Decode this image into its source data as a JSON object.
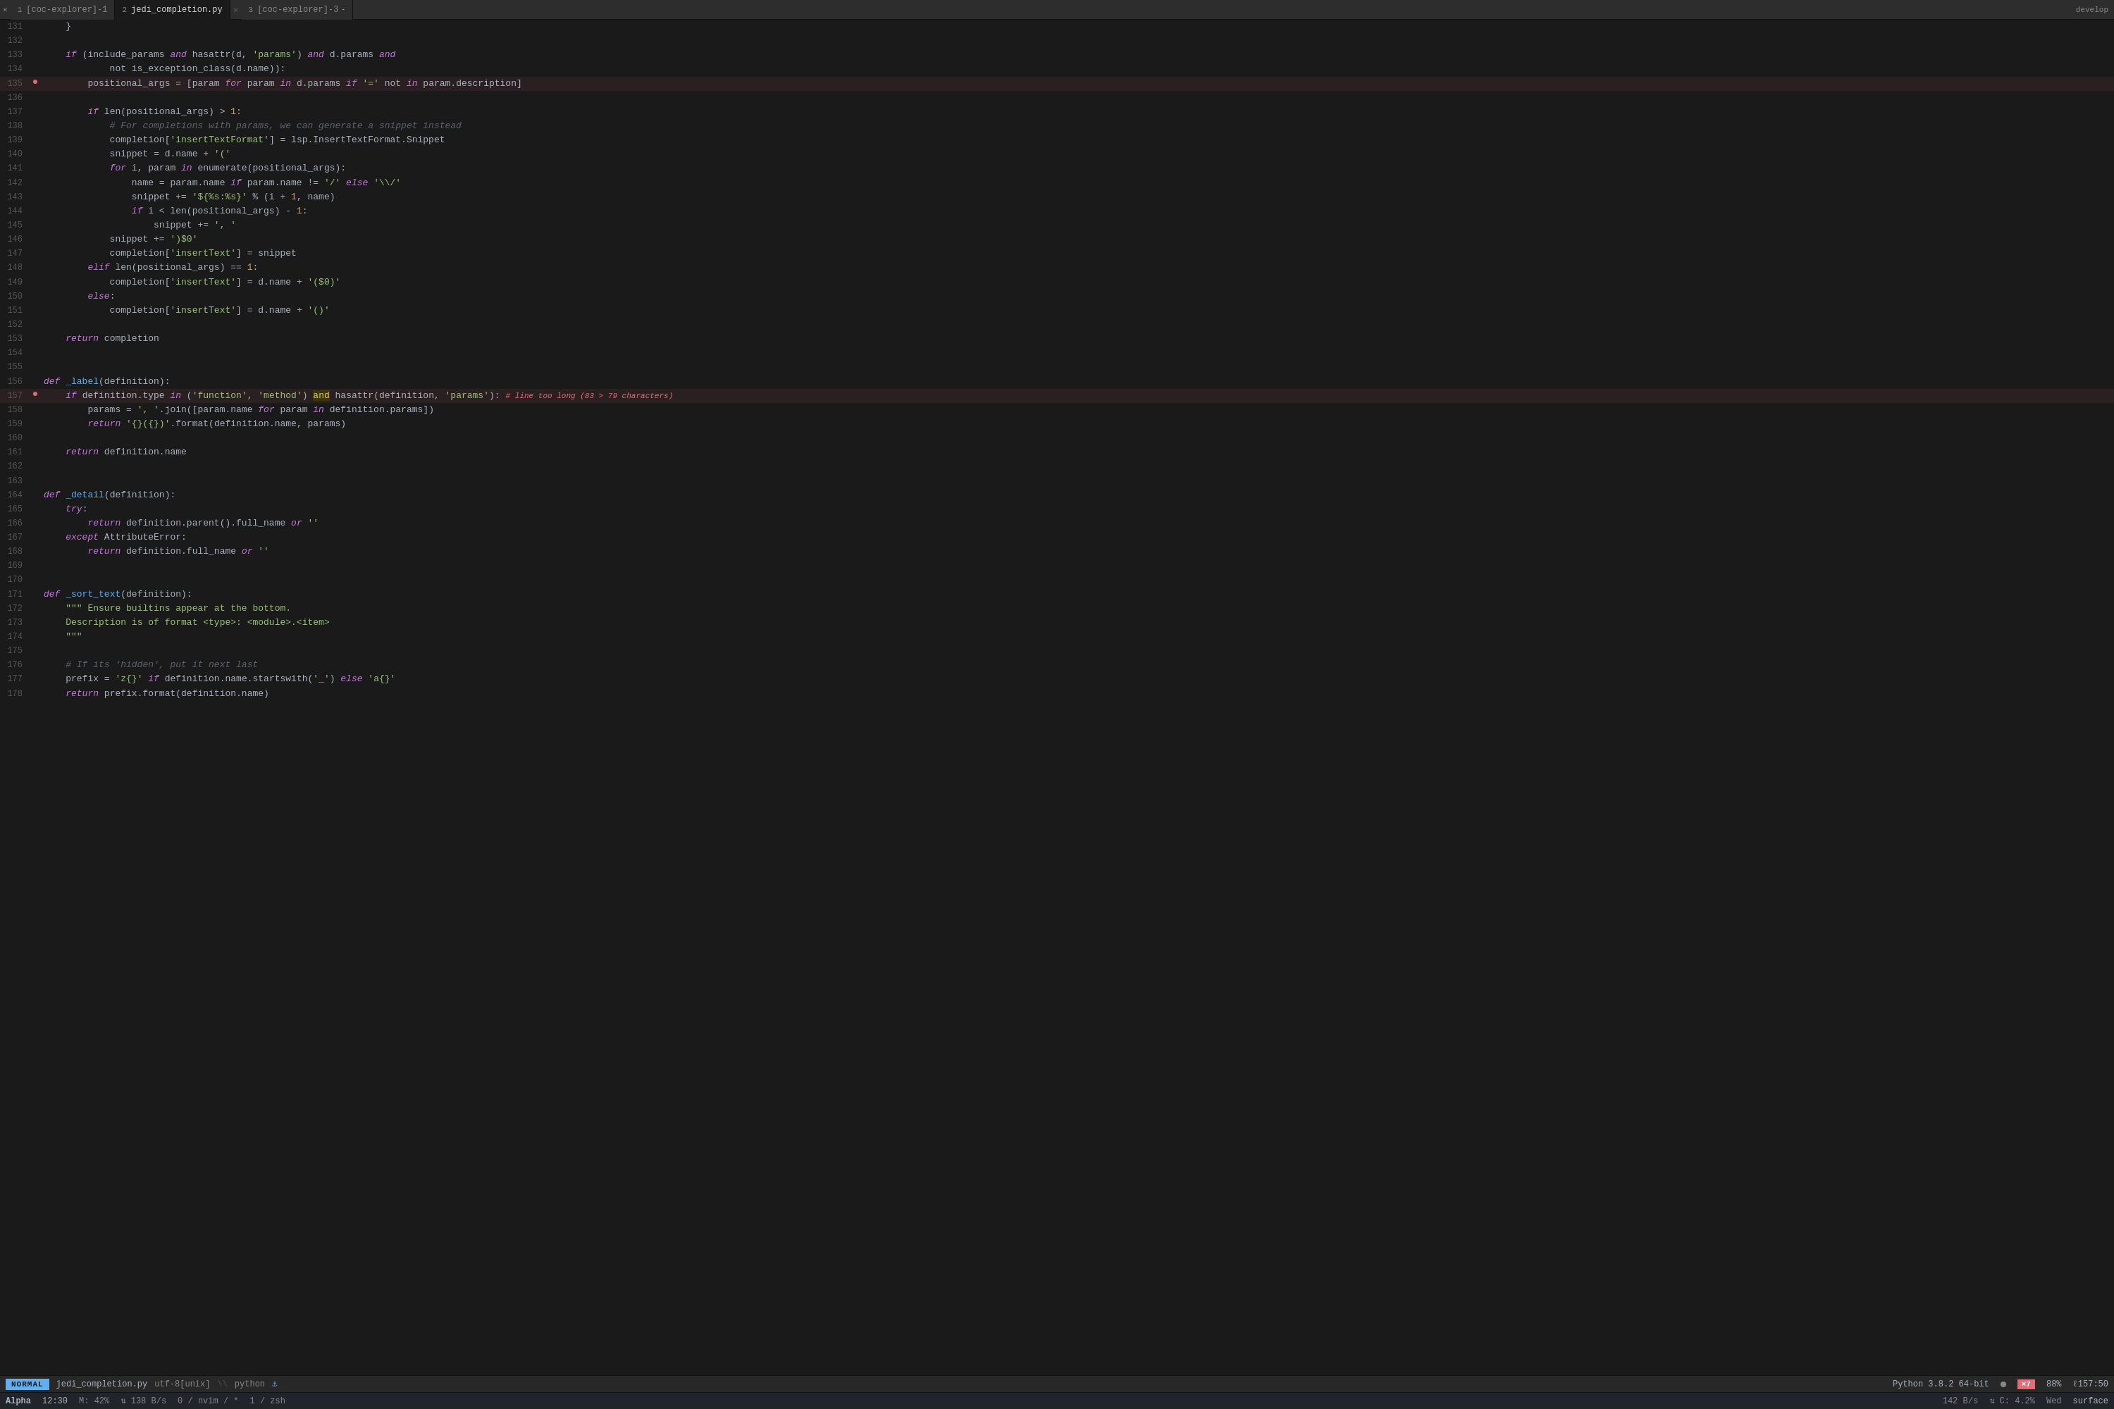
{
  "tabs": [
    {
      "num": "1",
      "label": "[coc-explorer]-1",
      "active": false,
      "modified": false
    },
    {
      "num": "2",
      "label": "jedi_completion.py",
      "active": true,
      "modified": false
    },
    {
      "num": "3",
      "label": "[coc-explorer]-3",
      "active": false,
      "modified": false
    }
  ],
  "tab_bar_right": "develop",
  "lines": [
    {
      "num": "131",
      "gutter": "",
      "content": [
        {
          "t": "plain",
          "v": "    }"
        }
      ]
    },
    {
      "num": "132",
      "gutter": "",
      "content": []
    },
    {
      "num": "133",
      "gutter": "",
      "content": [
        {
          "t": "plain",
          "v": "    "
        },
        {
          "t": "kw",
          "v": "if"
        },
        {
          "t": "plain",
          "v": " (include_params "
        },
        {
          "t": "kw",
          "v": "and"
        },
        {
          "t": "plain",
          "v": " hasattr(d, "
        },
        {
          "t": "str",
          "v": "'params'"
        },
        {
          "t": "plain",
          "v": ") "
        },
        {
          "t": "kw",
          "v": "and"
        },
        {
          "t": "plain",
          "v": " d.params "
        },
        {
          "t": "kw",
          "v": "and"
        }
      ]
    },
    {
      "num": "134",
      "gutter": "",
      "content": [
        {
          "t": "plain",
          "v": "            not is_exception_class(d.name)):"
        }
      ]
    },
    {
      "num": "135",
      "gutter": "error",
      "content": [
        {
          "t": "plain",
          "v": "        positional_args = [param "
        },
        {
          "t": "kw",
          "v": "for"
        },
        {
          "t": "plain",
          "v": " param "
        },
        {
          "t": "kw",
          "v": "in"
        },
        {
          "t": "plain",
          "v": " d.params "
        },
        {
          "t": "kw",
          "v": "if"
        },
        {
          "t": "plain",
          "v": " "
        },
        {
          "t": "str",
          "v": "'='"
        },
        {
          "t": "plain",
          "v": " not "
        },
        {
          "t": "kw",
          "v": "in"
        },
        {
          "t": "plain",
          "v": " param.description]"
        }
      ]
    },
    {
      "num": "136",
      "gutter": "",
      "content": []
    },
    {
      "num": "137",
      "gutter": "",
      "content": [
        {
          "t": "plain",
          "v": "        "
        },
        {
          "t": "kw",
          "v": "if"
        },
        {
          "t": "plain",
          "v": " len(positional_args) > "
        },
        {
          "t": "num",
          "v": "1"
        },
        {
          "t": "plain",
          "v": ":"
        }
      ]
    },
    {
      "num": "138",
      "gutter": "",
      "content": [
        {
          "t": "comment",
          "v": "            # For completions with params, we can generate a snippet instead"
        }
      ]
    },
    {
      "num": "139",
      "gutter": "",
      "content": [
        {
          "t": "plain",
          "v": "            completion["
        },
        {
          "t": "str",
          "v": "'insertTextFormat'"
        },
        {
          "t": "plain",
          "v": "] = lsp.InsertTextFormat.Snippet"
        }
      ]
    },
    {
      "num": "140",
      "gutter": "",
      "content": [
        {
          "t": "plain",
          "v": "            snippet = d.name + "
        },
        {
          "t": "str",
          "v": "'('"
        }
      ]
    },
    {
      "num": "141",
      "gutter": "",
      "content": [
        {
          "t": "plain",
          "v": "            "
        },
        {
          "t": "kw",
          "v": "for"
        },
        {
          "t": "plain",
          "v": " i, param "
        },
        {
          "t": "kw",
          "v": "in"
        },
        {
          "t": "plain",
          "v": " enumerate(positional_args):"
        }
      ]
    },
    {
      "num": "142",
      "gutter": "",
      "content": [
        {
          "t": "plain",
          "v": "                name = param.name "
        },
        {
          "t": "kw",
          "v": "if"
        },
        {
          "t": "plain",
          "v": " param.name != "
        },
        {
          "t": "str",
          "v": "'/'"
        },
        {
          "t": "plain",
          "v": " "
        },
        {
          "t": "kw",
          "v": "else"
        },
        {
          "t": "plain",
          "v": " "
        },
        {
          "t": "str",
          "v": "'\\\\/'"
        }
      ]
    },
    {
      "num": "143",
      "gutter": "",
      "content": [
        {
          "t": "plain",
          "v": "                snippet += "
        },
        {
          "t": "str",
          "v": "'${%s:%s}'"
        },
        {
          "t": "plain",
          "v": " % (i + "
        },
        {
          "t": "num",
          "v": "1"
        },
        {
          "t": "plain",
          "v": ", name)"
        }
      ]
    },
    {
      "num": "144",
      "gutter": "",
      "content": [
        {
          "t": "plain",
          "v": "                "
        },
        {
          "t": "kw",
          "v": "if"
        },
        {
          "t": "plain",
          "v": " i < len(positional_args) - "
        },
        {
          "t": "num",
          "v": "1"
        },
        {
          "t": "plain",
          "v": ":"
        }
      ]
    },
    {
      "num": "145",
      "gutter": "",
      "content": [
        {
          "t": "plain",
          "v": "                    snippet += "
        },
        {
          "t": "str",
          "v": "', '"
        }
      ]
    },
    {
      "num": "146",
      "gutter": "",
      "content": [
        {
          "t": "plain",
          "v": "            snippet += "
        },
        {
          "t": "str",
          "v": "')$0'"
        }
      ]
    },
    {
      "num": "147",
      "gutter": "",
      "content": [
        {
          "t": "plain",
          "v": "            completion["
        },
        {
          "t": "str",
          "v": "'insertText'"
        },
        {
          "t": "plain",
          "v": "] = snippet"
        }
      ]
    },
    {
      "num": "148",
      "gutter": "",
      "content": [
        {
          "t": "plain",
          "v": "        "
        },
        {
          "t": "kw",
          "v": "elif"
        },
        {
          "t": "plain",
          "v": " len(positional_args) == "
        },
        {
          "t": "num",
          "v": "1"
        },
        {
          "t": "plain",
          "v": ":"
        }
      ]
    },
    {
      "num": "149",
      "gutter": "",
      "content": [
        {
          "t": "plain",
          "v": "            completion["
        },
        {
          "t": "str",
          "v": "'insertText'"
        },
        {
          "t": "plain",
          "v": "] = d.name + "
        },
        {
          "t": "str",
          "v": "'($0)'"
        }
      ]
    },
    {
      "num": "150",
      "gutter": "",
      "content": [
        {
          "t": "plain",
          "v": "        "
        },
        {
          "t": "kw",
          "v": "else"
        },
        {
          "t": "plain",
          "v": ":"
        }
      ]
    },
    {
      "num": "151",
      "gutter": "",
      "content": [
        {
          "t": "plain",
          "v": "            completion["
        },
        {
          "t": "str",
          "v": "'insertText'"
        },
        {
          "t": "plain",
          "v": "] = d.name + "
        },
        {
          "t": "str",
          "v": "'()'"
        }
      ]
    },
    {
      "num": "152",
      "gutter": "",
      "content": []
    },
    {
      "num": "153",
      "gutter": "",
      "content": [
        {
          "t": "plain",
          "v": "    "
        },
        {
          "t": "kw",
          "v": "return"
        },
        {
          "t": "plain",
          "v": " completion"
        }
      ]
    },
    {
      "num": "154",
      "gutter": "",
      "content": []
    },
    {
      "num": "155",
      "gutter": "",
      "content": []
    },
    {
      "num": "156",
      "gutter": "",
      "content": [
        {
          "t": "kw",
          "v": "def"
        },
        {
          "t": "plain",
          "v": " "
        },
        {
          "t": "fn",
          "v": "_label"
        },
        {
          "t": "plain",
          "v": "(definition):"
        }
      ]
    },
    {
      "num": "157",
      "gutter": "error",
      "content": [
        {
          "t": "plain",
          "v": "    "
        },
        {
          "t": "kw",
          "v": "if"
        },
        {
          "t": "plain",
          "v": " definition.type "
        },
        {
          "t": "kw",
          "v": "in"
        },
        {
          "t": "plain",
          "v": " ("
        },
        {
          "t": "str",
          "v": "'function'"
        },
        {
          "t": "plain",
          "v": ", "
        },
        {
          "t": "str",
          "v": "'method'"
        },
        {
          "t": "plain",
          "v": ") "
        },
        {
          "t": "highlight-and",
          "v": "and"
        },
        {
          "t": "plain",
          "v": " hasattr(definition, "
        },
        {
          "t": "str",
          "v": "'params'"
        },
        {
          "t": "plain",
          "v": "):"
        },
        {
          "t": "inline-error",
          "v": "# line too long (83 > 79 characters)"
        }
      ]
    },
    {
      "num": "158",
      "gutter": "",
      "content": [
        {
          "t": "plain",
          "v": "        params = "
        },
        {
          "t": "str",
          "v": "', '"
        },
        {
          "t": "plain",
          "v": ".join([param.name "
        },
        {
          "t": "kw",
          "v": "for"
        },
        {
          "t": "plain",
          "v": " param "
        },
        {
          "t": "kw",
          "v": "in"
        },
        {
          "t": "plain",
          "v": " definition.params])"
        }
      ]
    },
    {
      "num": "159",
      "gutter": "",
      "content": [
        {
          "t": "plain",
          "v": "        "
        },
        {
          "t": "kw",
          "v": "return"
        },
        {
          "t": "plain",
          "v": " "
        },
        {
          "t": "str",
          "v": "'{}({})'"
        },
        {
          "t": "plain",
          "v": ".format(definition.name, params)"
        }
      ]
    },
    {
      "num": "160",
      "gutter": "",
      "content": []
    },
    {
      "num": "161",
      "gutter": "",
      "content": [
        {
          "t": "plain",
          "v": "    "
        },
        {
          "t": "kw",
          "v": "return"
        },
        {
          "t": "plain",
          "v": " definition.name"
        }
      ]
    },
    {
      "num": "162",
      "gutter": "",
      "content": []
    },
    {
      "num": "163",
      "gutter": "",
      "content": []
    },
    {
      "num": "164",
      "gutter": "",
      "content": [
        {
          "t": "kw",
          "v": "def"
        },
        {
          "t": "plain",
          "v": " "
        },
        {
          "t": "fn",
          "v": "_detail"
        },
        {
          "t": "plain",
          "v": "(definition):"
        }
      ]
    },
    {
      "num": "165",
      "gutter": "",
      "content": [
        {
          "t": "plain",
          "v": "    "
        },
        {
          "t": "kw",
          "v": "try"
        },
        {
          "t": "plain",
          "v": ":"
        }
      ]
    },
    {
      "num": "166",
      "gutter": "",
      "content": [
        {
          "t": "plain",
          "v": "        "
        },
        {
          "t": "kw",
          "v": "return"
        },
        {
          "t": "plain",
          "v": " definition.parent().full_name "
        },
        {
          "t": "kw",
          "v": "or"
        },
        {
          "t": "plain",
          "v": " "
        },
        {
          "t": "str",
          "v": "''"
        }
      ]
    },
    {
      "num": "167",
      "gutter": "",
      "content": [
        {
          "t": "plain",
          "v": "    "
        },
        {
          "t": "kw",
          "v": "except"
        },
        {
          "t": "plain",
          "v": " AttributeError:"
        }
      ]
    },
    {
      "num": "168",
      "gutter": "",
      "content": [
        {
          "t": "plain",
          "v": "        "
        },
        {
          "t": "kw",
          "v": "return"
        },
        {
          "t": "plain",
          "v": " definition.full_name "
        },
        {
          "t": "kw",
          "v": "or"
        },
        {
          "t": "plain",
          "v": " "
        },
        {
          "t": "str",
          "v": "''"
        }
      ]
    },
    {
      "num": "169",
      "gutter": "",
      "content": []
    },
    {
      "num": "170",
      "gutter": "",
      "content": []
    },
    {
      "num": "171",
      "gutter": "",
      "content": [
        {
          "t": "kw",
          "v": "def"
        },
        {
          "t": "plain",
          "v": " "
        },
        {
          "t": "fn",
          "v": "_sort_text"
        },
        {
          "t": "plain",
          "v": "(definition):"
        }
      ]
    },
    {
      "num": "172",
      "gutter": "",
      "content": [
        {
          "t": "plain",
          "v": "    "
        },
        {
          "t": "str",
          "v": "\"\"\" Ensure builtins appear at the bottom."
        }
      ]
    },
    {
      "num": "173",
      "gutter": "",
      "content": [
        {
          "t": "plain",
          "v": "    "
        },
        {
          "t": "str",
          "v": "Description is of format <type>: <module>.<item>"
        }
      ]
    },
    {
      "num": "174",
      "gutter": "",
      "content": [
        {
          "t": "plain",
          "v": "    "
        },
        {
          "t": "str",
          "v": "\"\"\""
        }
      ]
    },
    {
      "num": "175",
      "gutter": "",
      "content": []
    },
    {
      "num": "176",
      "gutter": "",
      "content": [
        {
          "t": "comment",
          "v": "    # If its 'hidden', put it next last"
        }
      ]
    },
    {
      "num": "177",
      "gutter": "",
      "content": [
        {
          "t": "plain",
          "v": "    prefix = "
        },
        {
          "t": "str",
          "v": "'z{}'"
        },
        {
          "t": "plain",
          "v": " "
        },
        {
          "t": "kw",
          "v": "if"
        },
        {
          "t": "plain",
          "v": " definition.name.startswith("
        },
        {
          "t": "str",
          "v": "'_'"
        },
        {
          "t": "plain",
          "v": ") "
        },
        {
          "t": "kw",
          "v": "else"
        },
        {
          "t": "plain",
          "v": " "
        },
        {
          "t": "str",
          "v": "'a{}'"
        }
      ]
    },
    {
      "num": "178",
      "gutter": "",
      "content": [
        {
          "t": "plain",
          "v": "    "
        },
        {
          "t": "kw",
          "v": "return"
        },
        {
          "t": "plain",
          "v": " prefix.format(definition.name)"
        }
      ]
    }
  ],
  "status_main": {
    "mode": "NORMAL",
    "file": "jedi_completion.py",
    "encoding": "utf-8[unix]",
    "filetype": "python",
    "python_version": "Python 3.8.2 64-bit",
    "dot_color": "#888888",
    "error_badge": "×7",
    "percent": "88%",
    "position": "ℓ157:50"
  },
  "status_bottom": {
    "alpha": "Alpha",
    "time": "12:30",
    "misc1": "M: 42%",
    "misc2": "⇅ 138 B/s",
    "nvim_info": "0 / nvim / *",
    "zsh_info": "1 / zsh",
    "right1": "142 B/s",
    "right2": "⇅ C: 4.2%",
    "right3": "Wed",
    "surface": "surface"
  }
}
